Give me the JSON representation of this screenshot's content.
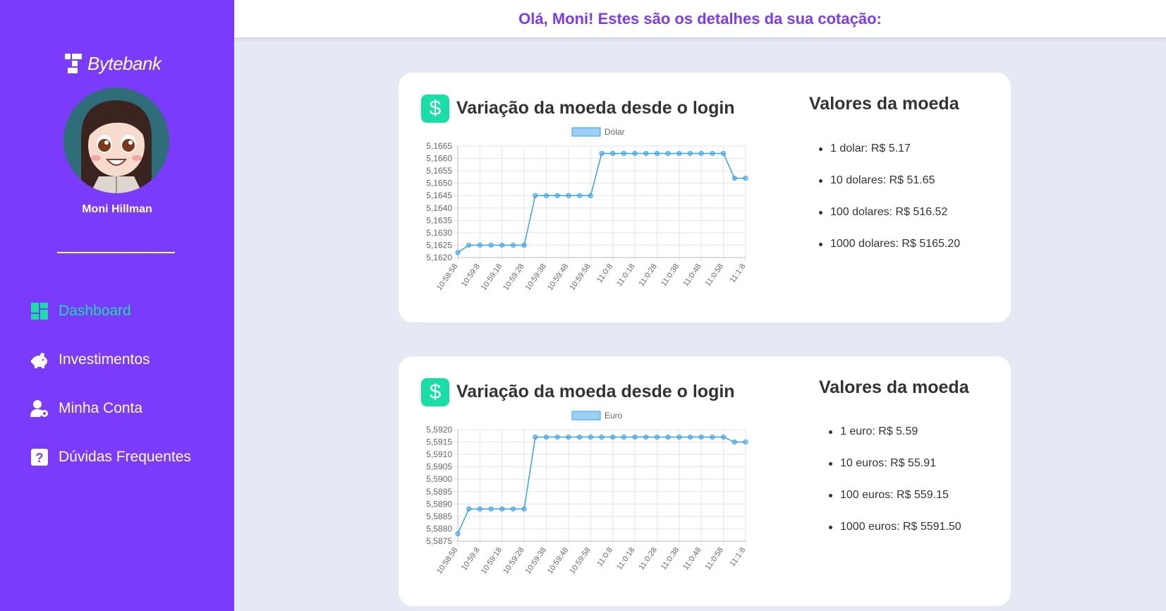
{
  "app": {
    "logo_text": "Bytebank"
  },
  "user": {
    "name": "Moni Hillman"
  },
  "header": {
    "greeting": "Olá, Moni! Estes são os detalhes da sua cotação:"
  },
  "nav": {
    "items": [
      {
        "label": "Dashboard",
        "icon": "dashboard-icon",
        "active": true
      },
      {
        "label": "Investimentos",
        "icon": "piggy-bank-icon",
        "active": false
      },
      {
        "label": "Minha Conta",
        "icon": "user-gear-icon",
        "active": false
      },
      {
        "label": "Dúvidas Frequentes",
        "icon": "question-icon",
        "active": false
      }
    ]
  },
  "colors": {
    "sidebar": "#7b3bfb",
    "accent": "#19dfa7",
    "background": "#e4e9f4",
    "chart_line": "#36a2eb"
  },
  "cards": [
    {
      "badge": "$",
      "title": "Variação da moeda desde o login",
      "values_title": "Valores da moeda",
      "values": [
        "1 dolar: R$ 5.17",
        "10 dolares: R$ 51.65",
        "100 dolares: R$ 516.52",
        "1000 dolares: R$ 5165.20"
      ]
    },
    {
      "badge": "$",
      "title": "Variação da moeda desde o login",
      "values_title": "Valores da moeda",
      "values": [
        "1 euro: R$ 5.59",
        "10 euros: R$ 55.91",
        "100 euros: R$ 559.15",
        "1000 euros: R$ 5591.50"
      ]
    }
  ],
  "chart_data": [
    {
      "type": "line",
      "legend": "Dólar",
      "x": [
        "10:58:58",
        "10:59:3",
        "10:59:8",
        "10:59:13",
        "10:59:18",
        "10:59:23",
        "10:59:28",
        "10:59:33",
        "10:59:38",
        "10:59:43",
        "10:59:48",
        "10:59:53",
        "10:59:58",
        "11:0:3",
        "11:0:8",
        "11:0:13",
        "11:0:18",
        "11:0:23",
        "11:0:28",
        "11:0:33",
        "11:0:38",
        "11:0:43",
        "11:0:48",
        "11:0:53",
        "11:0:58",
        "11:1:3",
        "11:1:8"
      ],
      "x_tick_labels": [
        "10:58:58",
        "10:59:8",
        "10:59:18",
        "10:59:28",
        "10:59:38",
        "10:59:48",
        "10:59:58",
        "11:0:8",
        "11:0:18",
        "11:0:28",
        "11:0:38",
        "11:0:48",
        "11:0:58",
        "11:1:8"
      ],
      "values": [
        5.1622,
        5.1625,
        5.1625,
        5.1625,
        5.1625,
        5.1625,
        5.1625,
        5.1645,
        5.1645,
        5.1645,
        5.1645,
        5.1645,
        5.1645,
        5.1662,
        5.1662,
        5.1662,
        5.1662,
        5.1662,
        5.1662,
        5.1662,
        5.1662,
        5.1662,
        5.1662,
        5.1662,
        5.1662,
        5.1652,
        5.1652
      ],
      "ylim": [
        5.162,
        5.1665
      ],
      "y_ticks": [
        "5,1665",
        "5,1660",
        "5,1655",
        "5,1650",
        "5,1645",
        "5,1640",
        "5,1635",
        "5,1630",
        "5,1625",
        "5,1620"
      ],
      "grid": true,
      "legend_position": "top"
    },
    {
      "type": "line",
      "legend": "Euro",
      "x": [
        "10:58:58",
        "10:59:3",
        "10:59:8",
        "10:59:13",
        "10:59:18",
        "10:59:23",
        "10:59:28",
        "10:59:33",
        "10:59:38",
        "10:59:43",
        "10:59:48",
        "10:59:53",
        "10:59:58",
        "11:0:3",
        "11:0:8",
        "11:0:13",
        "11:0:18",
        "11:0:23",
        "11:0:28",
        "11:0:33",
        "11:0:38",
        "11:0:43",
        "11:0:48",
        "11:0:53",
        "11:0:58",
        "11:1:3",
        "11:1:8"
      ],
      "x_tick_labels": [
        "10:58:58",
        "10:59:8",
        "10:59:18",
        "10:59:28",
        "10:59:38",
        "10:59:48",
        "10:59:58",
        "11:0:8",
        "11:0:18",
        "11:0:28",
        "11:0:38",
        "11:0:48",
        "11:0:58",
        "11:1:8"
      ],
      "values": [
        5.5878,
        5.5888,
        5.5888,
        5.5888,
        5.5888,
        5.5888,
        5.5888,
        5.5917,
        5.5917,
        5.5917,
        5.5917,
        5.5917,
        5.5917,
        5.5917,
        5.5917,
        5.5917,
        5.5917,
        5.5917,
        5.5917,
        5.5917,
        5.5917,
        5.5917,
        5.5917,
        5.5917,
        5.5917,
        5.5915,
        5.5915
      ],
      "ylim": [
        5.5875,
        5.592
      ],
      "y_ticks": [
        "5,5920",
        "5,5915",
        "5,5910",
        "5,5905",
        "5,5900",
        "5,5895",
        "5,5890",
        "5,5885",
        "5,5880",
        "5,5875"
      ],
      "grid": true,
      "legend_position": "top"
    }
  ]
}
